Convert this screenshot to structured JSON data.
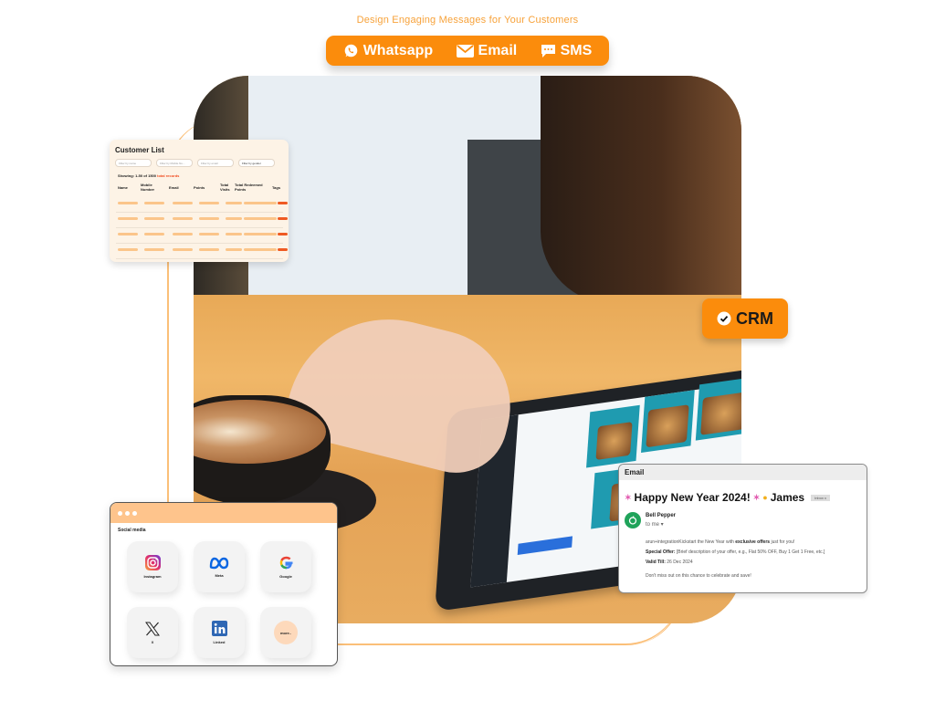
{
  "tagline": "Design Engaging Messages for Your Customers",
  "channels": [
    {
      "label": "Whatsapp",
      "icon": "whatsapp-icon"
    },
    {
      "label": "Email",
      "icon": "envelope-icon"
    },
    {
      "label": "SMS",
      "icon": "chat-bubble-icon"
    }
  ],
  "colors": {
    "accent": "#fb8c0c",
    "accent_light": "#fec48c",
    "line": "#fbbf78",
    "tag": "#ef5a22"
  },
  "customer_list": {
    "title": "Customer List",
    "filters": [
      "Filter by name",
      "Filter by Mobile Nu...",
      "Filter by email",
      "Filter by gender"
    ],
    "showing": "Showing: 1-50 of 1500",
    "total": "total records",
    "columns": [
      "Name",
      "Mobile Number",
      "Email",
      "Points",
      "Total Visits",
      "Total Redeemed Points",
      "Tags"
    ],
    "row_count": 4
  },
  "crm_badge": {
    "label": "CRM",
    "icon": "check-circle-icon"
  },
  "email": {
    "window_title": "Email",
    "subject": "Happy New Year 2024!",
    "recipient_name": "James",
    "inbox_label": "Inbox x",
    "sender": "Bell Pepper",
    "to": "to me",
    "line1_pre": "arun+integrationKickstart the New Year with ",
    "line1_bold": "exclusive offers",
    "line1_post": " just for you!",
    "offer_label": "Special Offer:",
    "offer_text": " [Brief description of your offer, e.g., Flat 50% OFF, Buy 1 Get 1 Free, etc.]",
    "valid_label": "Valid Till:",
    "valid_text": " 26 Dec 2024",
    "closing": "Don't miss out on this chance to celebrate and save!"
  },
  "social": {
    "title": "Social media",
    "items": [
      {
        "label": "Instagram",
        "icon": "instagram-icon"
      },
      {
        "label": "Meta",
        "icon": "meta-icon"
      },
      {
        "label": "Google",
        "icon": "google-icon"
      },
      {
        "label": "X",
        "icon": "x-icon"
      },
      {
        "label": "Linked",
        "icon": "linkedin-icon"
      },
      {
        "label": "more..",
        "icon": "more-icon"
      }
    ]
  }
}
